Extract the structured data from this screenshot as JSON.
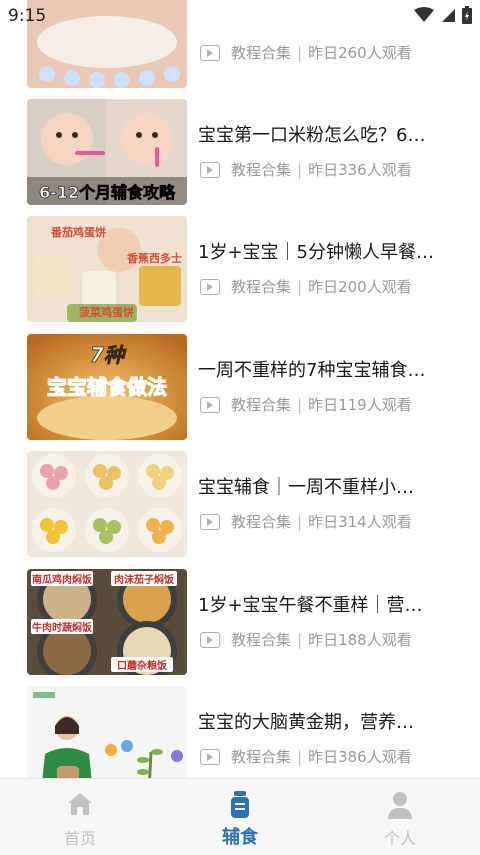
{
  "status": {
    "time": "9:15"
  },
  "feed": [
    {
      "title": "",
      "category": "教程合集",
      "stats": "昨日260人观看",
      "thumb": {
        "bg": "#f2d7c8",
        "lines": []
      }
    },
    {
      "title": "宝宝第一口米粉怎么吃？6…",
      "category": "教程合集",
      "stats": "昨日336人观看",
      "thumb": {
        "bg": "#e8dcd4",
        "lines": [
          "6-12个月辅食攻略"
        ]
      }
    },
    {
      "title": "1岁+宝宝｜5分钟懒人早餐…",
      "category": "教程合集",
      "stats": "昨日200人观看",
      "thumb": {
        "bg": "#efe6d2",
        "lines": [
          "番茄鸡蛋饼",
          "香蕉西多士",
          "菠菜鸡蛋饼"
        ]
      }
    },
    {
      "title": "一周不重样的7种宝宝辅食…",
      "category": "教程合集",
      "stats": "昨日119人观看",
      "thumb": {
        "bg": "#e7a44a",
        "lines": [
          "7种",
          "宝宝辅食做法"
        ]
      }
    },
    {
      "title": "宝宝辅食｜一周不重样小…",
      "category": "教程合集",
      "stats": "昨日314人观看",
      "thumb": {
        "bg": "#efe9dc",
        "lines": []
      }
    },
    {
      "title": "1岁+宝宝午餐不重样｜营…",
      "category": "教程合集",
      "stats": "昨日188人观看",
      "thumb": {
        "bg": "#7a6a55",
        "lines": [
          "南瓜鸡肉焖饭",
          "肉沫茄子焖饭",
          "牛肉时蔬焖饭",
          "口蘑杂粮饭"
        ]
      }
    },
    {
      "title": "宝宝的大脑黄金期，营养…",
      "category": "教程合集",
      "stats": "昨日386人观看",
      "thumb": {
        "bg": "#f4f6f3",
        "lines": []
      }
    }
  ],
  "tabbar": {
    "home": "首页",
    "food": "辅食",
    "profile": "个人",
    "active_color": "#2f6fb3",
    "inactive_color": "#c2c2c2"
  }
}
